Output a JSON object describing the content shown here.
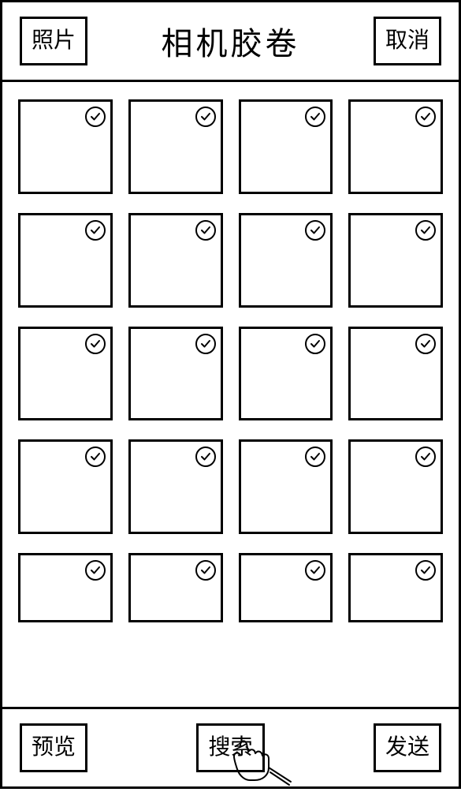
{
  "header": {
    "photos_label": "照片",
    "title": "相机胶卷",
    "cancel_label": "取消"
  },
  "grid": {
    "rows": 5,
    "cols": 4,
    "all_checked": true
  },
  "footer": {
    "preview_label": "预览",
    "search_label": "搜索",
    "send_label": "发送"
  }
}
